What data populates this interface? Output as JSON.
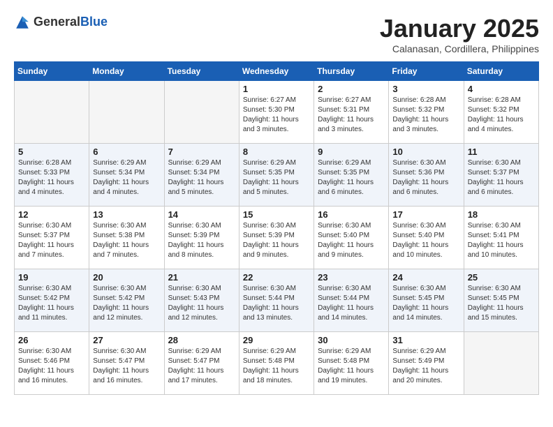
{
  "header": {
    "logo_general": "General",
    "logo_blue": "Blue",
    "title": "January 2025",
    "subtitle": "Calanasan, Cordillera, Philippines"
  },
  "weekdays": [
    "Sunday",
    "Monday",
    "Tuesday",
    "Wednesday",
    "Thursday",
    "Friday",
    "Saturday"
  ],
  "weeks": [
    [
      {
        "day": "",
        "info": ""
      },
      {
        "day": "",
        "info": ""
      },
      {
        "day": "",
        "info": ""
      },
      {
        "day": "1",
        "info": "Sunrise: 6:27 AM\nSunset: 5:30 PM\nDaylight: 11 hours\nand 3 minutes."
      },
      {
        "day": "2",
        "info": "Sunrise: 6:27 AM\nSunset: 5:31 PM\nDaylight: 11 hours\nand 3 minutes."
      },
      {
        "day": "3",
        "info": "Sunrise: 6:28 AM\nSunset: 5:32 PM\nDaylight: 11 hours\nand 3 minutes."
      },
      {
        "day": "4",
        "info": "Sunrise: 6:28 AM\nSunset: 5:32 PM\nDaylight: 11 hours\nand 4 minutes."
      }
    ],
    [
      {
        "day": "5",
        "info": "Sunrise: 6:28 AM\nSunset: 5:33 PM\nDaylight: 11 hours\nand 4 minutes."
      },
      {
        "day": "6",
        "info": "Sunrise: 6:29 AM\nSunset: 5:34 PM\nDaylight: 11 hours\nand 4 minutes."
      },
      {
        "day": "7",
        "info": "Sunrise: 6:29 AM\nSunset: 5:34 PM\nDaylight: 11 hours\nand 5 minutes."
      },
      {
        "day": "8",
        "info": "Sunrise: 6:29 AM\nSunset: 5:35 PM\nDaylight: 11 hours\nand 5 minutes."
      },
      {
        "day": "9",
        "info": "Sunrise: 6:29 AM\nSunset: 5:35 PM\nDaylight: 11 hours\nand 6 minutes."
      },
      {
        "day": "10",
        "info": "Sunrise: 6:30 AM\nSunset: 5:36 PM\nDaylight: 11 hours\nand 6 minutes."
      },
      {
        "day": "11",
        "info": "Sunrise: 6:30 AM\nSunset: 5:37 PM\nDaylight: 11 hours\nand 6 minutes."
      }
    ],
    [
      {
        "day": "12",
        "info": "Sunrise: 6:30 AM\nSunset: 5:37 PM\nDaylight: 11 hours\nand 7 minutes."
      },
      {
        "day": "13",
        "info": "Sunrise: 6:30 AM\nSunset: 5:38 PM\nDaylight: 11 hours\nand 7 minutes."
      },
      {
        "day": "14",
        "info": "Sunrise: 6:30 AM\nSunset: 5:39 PM\nDaylight: 11 hours\nand 8 minutes."
      },
      {
        "day": "15",
        "info": "Sunrise: 6:30 AM\nSunset: 5:39 PM\nDaylight: 11 hours\nand 9 minutes."
      },
      {
        "day": "16",
        "info": "Sunrise: 6:30 AM\nSunset: 5:40 PM\nDaylight: 11 hours\nand 9 minutes."
      },
      {
        "day": "17",
        "info": "Sunrise: 6:30 AM\nSunset: 5:40 PM\nDaylight: 11 hours\nand 10 minutes."
      },
      {
        "day": "18",
        "info": "Sunrise: 6:30 AM\nSunset: 5:41 PM\nDaylight: 11 hours\nand 10 minutes."
      }
    ],
    [
      {
        "day": "19",
        "info": "Sunrise: 6:30 AM\nSunset: 5:42 PM\nDaylight: 11 hours\nand 11 minutes."
      },
      {
        "day": "20",
        "info": "Sunrise: 6:30 AM\nSunset: 5:42 PM\nDaylight: 11 hours\nand 12 minutes."
      },
      {
        "day": "21",
        "info": "Sunrise: 6:30 AM\nSunset: 5:43 PM\nDaylight: 11 hours\nand 12 minutes."
      },
      {
        "day": "22",
        "info": "Sunrise: 6:30 AM\nSunset: 5:44 PM\nDaylight: 11 hours\nand 13 minutes."
      },
      {
        "day": "23",
        "info": "Sunrise: 6:30 AM\nSunset: 5:44 PM\nDaylight: 11 hours\nand 14 minutes."
      },
      {
        "day": "24",
        "info": "Sunrise: 6:30 AM\nSunset: 5:45 PM\nDaylight: 11 hours\nand 14 minutes."
      },
      {
        "day": "25",
        "info": "Sunrise: 6:30 AM\nSunset: 5:45 PM\nDaylight: 11 hours\nand 15 minutes."
      }
    ],
    [
      {
        "day": "26",
        "info": "Sunrise: 6:30 AM\nSunset: 5:46 PM\nDaylight: 11 hours\nand 16 minutes."
      },
      {
        "day": "27",
        "info": "Sunrise: 6:30 AM\nSunset: 5:47 PM\nDaylight: 11 hours\nand 16 minutes."
      },
      {
        "day": "28",
        "info": "Sunrise: 6:29 AM\nSunset: 5:47 PM\nDaylight: 11 hours\nand 17 minutes."
      },
      {
        "day": "29",
        "info": "Sunrise: 6:29 AM\nSunset: 5:48 PM\nDaylight: 11 hours\nand 18 minutes."
      },
      {
        "day": "30",
        "info": "Sunrise: 6:29 AM\nSunset: 5:48 PM\nDaylight: 11 hours\nand 19 minutes."
      },
      {
        "day": "31",
        "info": "Sunrise: 6:29 AM\nSunset: 5:49 PM\nDaylight: 11 hours\nand 20 minutes."
      },
      {
        "day": "",
        "info": ""
      }
    ]
  ]
}
